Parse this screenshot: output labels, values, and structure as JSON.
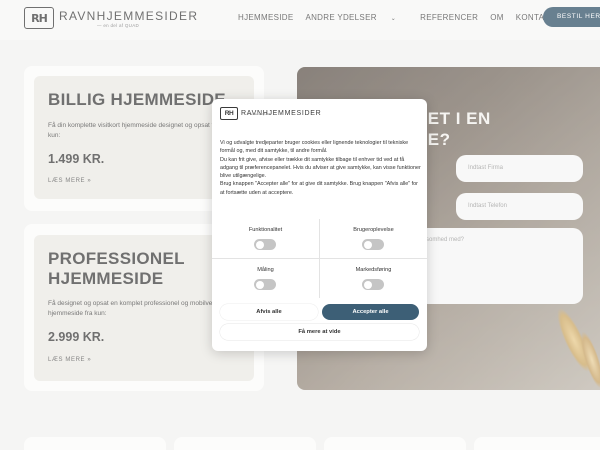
{
  "header": {
    "logo_mark": "RH",
    "logo_name": "RAVNHJEMMESIDER",
    "logo_sub": "— en del af QUAD",
    "nav": [
      {
        "label": "HJEMMESIDE"
      },
      {
        "label": "ANDRE YDELSER"
      },
      {
        "label": "REFERENCER"
      },
      {
        "label": "OM"
      },
      {
        "label": "KONTAKT"
      }
    ],
    "dropdown_icon": "chevron-down-icon",
    "cta": "BESTIL HER"
  },
  "cards": [
    {
      "title": "BILLIG HJEMMESIDE",
      "desc": "Få din komplette visitkort hjemmeside designet og opsat fra kun:",
      "price": "1.499 KR.",
      "link": "LÆS MERE »"
    },
    {
      "title": "PROFESSIONEL HJEMMESIDE",
      "title_line1": "PROFESSIONEL",
      "title_line2": "HJEMMESIDE",
      "desc": "Få designet og opsat en komplet professionel og mobilvenlig hjemmeside fra kun:",
      "price": "2.999 KR.",
      "link": "LÆS MERE »"
    }
  ],
  "hero": {
    "title_line1": "RET I EN",
    "title_line2": "DE?",
    "fields": {
      "firma": "Indtast Firma",
      "telefon": "Indtast Telefon",
      "message": "somhed med?"
    }
  },
  "cookie": {
    "logo_mark": "RH",
    "logo_name": "RAVNHJEMMESIDER",
    "logo_sub": "— en del af QUAD",
    "paragraphs": [
      "Vi og udvalgte tredjeparter bruger cookies eller lignende teknologier til tekniske formål og, med dit samtykke, til andre formål.",
      "Du kan frit give, afvise eller trække dit samtykke tilbage til enhver tid ved at få adgang til præferencepanelet. Hvis du afviser at give samtykke, kan visse funktioner blive utilgængelige.",
      "Brug knappen \"Accepter alle\" for at give dit samtykke. Brug knappen \"Afvis alle\" for at fortsætte uden at acceptere."
    ],
    "toggles": [
      {
        "label": "Funktionalitet",
        "on": false
      },
      {
        "label": "Brugeroplevelse",
        "on": false
      },
      {
        "label": "Måling",
        "on": false
      },
      {
        "label": "Markedsføring",
        "on": false
      }
    ],
    "reject_label": "Afvis alle",
    "accept_label": "Accepter alle",
    "more_label": "Få mere at vide"
  },
  "colors": {
    "brand_dark": "#2e4f66",
    "accept_button": "#3d5f76",
    "card_beige": "#ebe9e3",
    "page_bg": "#f1f1f0"
  }
}
